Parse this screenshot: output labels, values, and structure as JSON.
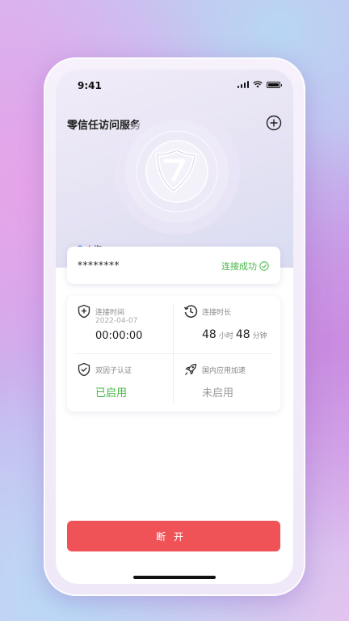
{
  "status_bar": {
    "time": "9:41"
  },
  "header": {
    "title": "零信任访问服务"
  },
  "location": {
    "label": "上海"
  },
  "connection": {
    "name": "********",
    "status": "连接成功"
  },
  "stats": {
    "connect_time": {
      "label": "连接时间",
      "date": "2022-04-07",
      "value": "00:00:00"
    },
    "duration": {
      "label": "连接时长",
      "hours": "48",
      "hours_unit": "小时",
      "minutes": "48",
      "minutes_unit": "分钟"
    },
    "two_factor": {
      "label": "双因子认证",
      "value": "已启用"
    },
    "domestic_accel": {
      "label": "国内应用加速",
      "value": "未启用"
    }
  },
  "actions": {
    "disconnect_label": "断开"
  },
  "colors": {
    "accent_green": "#45b845",
    "danger_red": "#ef5357"
  },
  "icons": [
    "signal-icon",
    "wifi-icon",
    "battery-icon",
    "add-circle-icon",
    "shield-logo-icon",
    "location-pin-icon",
    "check-circle-icon",
    "shield-plus-icon",
    "clock-icon",
    "shield-check-icon",
    "rocket-icon"
  ]
}
